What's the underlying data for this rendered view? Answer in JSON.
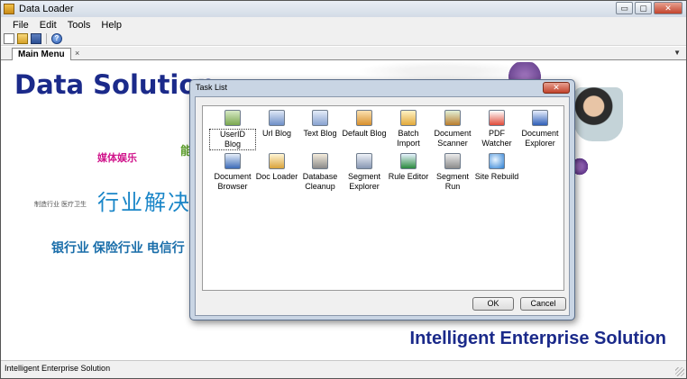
{
  "window": {
    "title": "Data Loader",
    "minimize_glyph": "▭",
    "maximize_glyph": "▢",
    "close_glyph": "✕"
  },
  "menu": [
    "File",
    "Edit",
    "Tools",
    "Help"
  ],
  "toolbar": {
    "icons": [
      "new-file-icon",
      "open-folder-icon",
      "save-icon",
      "help-icon"
    ],
    "help_glyph": "?"
  },
  "tabs": {
    "active": "Main Menu",
    "close_glyph": "×",
    "dropdown_glyph": "▼"
  },
  "background": {
    "title": "Data Solution",
    "cn_media": "媒体娱乐",
    "cn_neng": "能",
    "cn_small": "制造行业 医疗卫生",
    "cn_industry": "行业解决",
    "cn_banks": "银行业 保险行业 电信行",
    "tagline": "Intelligent Enterprise Solution"
  },
  "dialog": {
    "title": "Task List",
    "close_glyph": "✕",
    "tasks": [
      {
        "label": "UserID Blog",
        "icon": "userid-blog-icon",
        "selected": true
      },
      {
        "label": "Url Blog",
        "icon": "url-blog-icon"
      },
      {
        "label": "Text Blog",
        "icon": "text-blog-icon"
      },
      {
        "label": "Default Blog",
        "icon": "default-blog-icon"
      },
      {
        "label": "Batch Import",
        "icon": "batch-import-icon"
      },
      {
        "label": "Document Scanner",
        "icon": "document-scanner-icon"
      },
      {
        "label": "PDF Watcher",
        "icon": "pdf-watcher-icon"
      },
      {
        "label": "Document Explorer",
        "icon": "document-explorer-icon"
      },
      {
        "label": "Document Browser",
        "icon": "document-browser-icon"
      },
      {
        "label": "Doc Loader",
        "icon": "doc-loader-icon"
      },
      {
        "label": "Database Cleanup",
        "icon": "database-cleanup-icon"
      },
      {
        "label": "Segment Explorer",
        "icon": "segment-explorer-icon"
      },
      {
        "label": "Rule Editor",
        "icon": "rule-editor-icon"
      },
      {
        "label": "Segment Run",
        "icon": "segment-run-icon"
      },
      {
        "label": "Site Rebuild",
        "icon": "site-rebuild-icon"
      }
    ],
    "ok_label": "OK",
    "cancel_label": "Cancel"
  },
  "status": {
    "text": "Intelligent Enterprise Solution"
  }
}
